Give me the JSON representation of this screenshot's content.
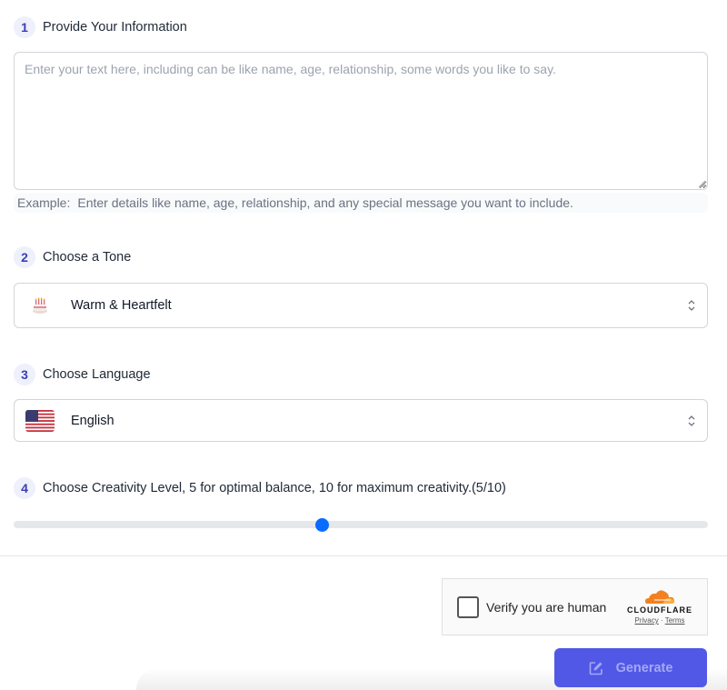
{
  "steps": [
    {
      "number": "1",
      "label": "Provide Your Information"
    },
    {
      "number": "2",
      "label": "Choose a Tone"
    },
    {
      "number": "3",
      "label": "Choose Language"
    },
    {
      "number": "4",
      "label": "Choose Creativity Level, 5 for optimal balance, 10 for maximum creativity.(5/10)"
    }
  ],
  "info": {
    "value": "",
    "placeholder": "Enter your text here, including can be like name, age, relationship, some words you like to say.",
    "example_label": "Example:",
    "example_text": "Enter details like name, age, relationship, and any special message you want to include."
  },
  "tone": {
    "selected": "Warm & Heartfelt",
    "icon": "birthday-cake-icon"
  },
  "language": {
    "selected": "English",
    "icon": "us-flag-icon"
  },
  "creativity": {
    "value": 5,
    "min": 1,
    "max": 10,
    "accent": "#0a6cff"
  },
  "captcha": {
    "label": "Verify you are human",
    "brand": "CLOUDFLARE",
    "privacy": "Privacy",
    "separator": "·",
    "terms": "Terms",
    "brand_color": "#f38020"
  },
  "generate": {
    "label": "Generate",
    "bg": "#5158e6"
  }
}
